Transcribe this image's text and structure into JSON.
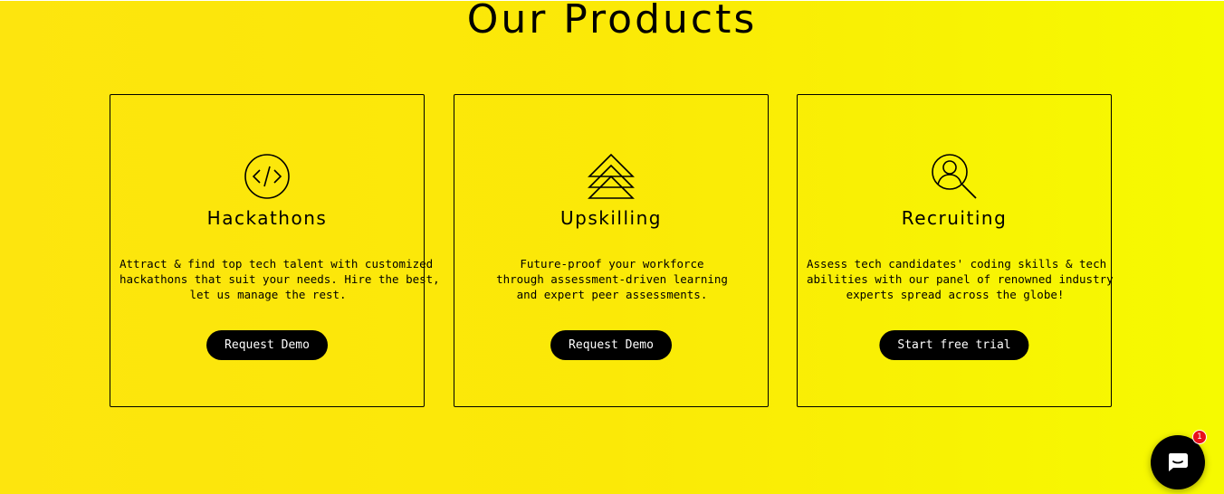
{
  "page": {
    "title": "Our Products",
    "accent_colors": [
      "#fde50e",
      "#f6fa00"
    ]
  },
  "products": [
    {
      "icon": "code-circle-icon",
      "title": "Hackathons",
      "description": [
        "Attract & find top tech talent with customized",
        "hackathons that suit your needs. Hire the best,",
        "let us manage the rest."
      ],
      "button_label": "Request Demo"
    },
    {
      "icon": "stacked-triangles-icon",
      "title": "Upskilling",
      "description": [
        "Future-proof your workforce",
        "through assessment-driven learning",
        "and expert peer assessments."
      ],
      "button_label": "Request Demo"
    },
    {
      "icon": "person-search-icon",
      "title": "Recruiting",
      "description": [
        "Assess tech candidates' coding skills & tech",
        "abilities with our panel of renowned industry",
        "experts spread across the globe!"
      ],
      "button_label": "Start free trial"
    }
  ],
  "chat": {
    "icon": "chat-bubble-icon",
    "badge_count": "1"
  }
}
